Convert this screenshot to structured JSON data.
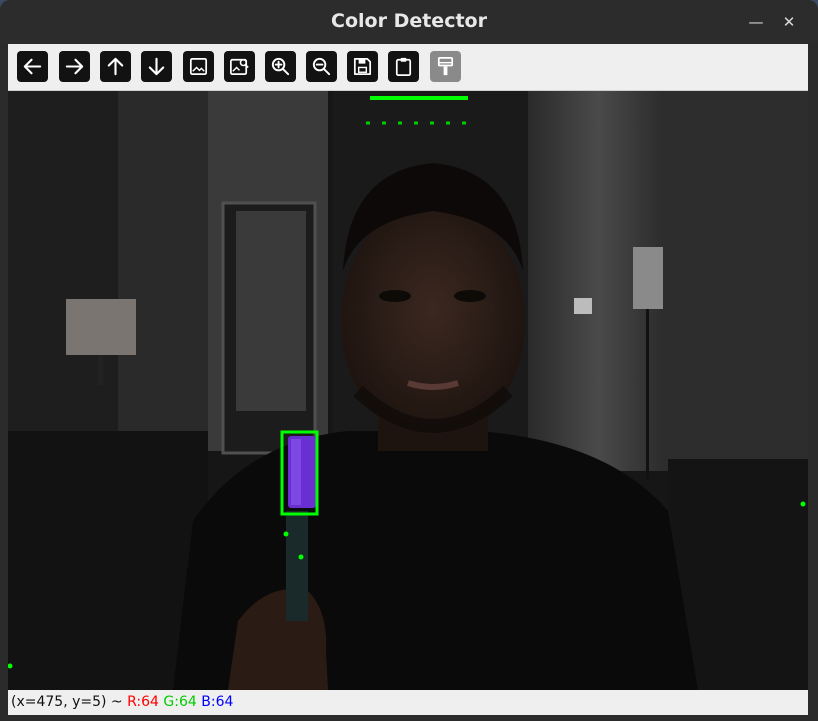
{
  "window": {
    "title": "Color Detector",
    "minimize_icon": "minimize-icon",
    "close_icon": "close-icon"
  },
  "toolbar": {
    "tools": [
      {
        "name": "pan-left",
        "icon": "arrow-left-icon"
      },
      {
        "name": "pan-right",
        "icon": "arrow-right-icon"
      },
      {
        "name": "pan-up",
        "icon": "arrow-up-icon"
      },
      {
        "name": "pan-down",
        "icon": "arrow-down-icon"
      },
      {
        "name": "zoom-fit",
        "icon": "image-icon"
      },
      {
        "name": "zoom-original",
        "icon": "image-search-icon"
      },
      {
        "name": "zoom-in",
        "icon": "zoom-in-icon"
      },
      {
        "name": "zoom-out",
        "icon": "zoom-out-icon"
      },
      {
        "name": "save",
        "icon": "save-icon"
      },
      {
        "name": "copy",
        "icon": "clipboard-icon"
      },
      {
        "name": "properties",
        "icon": "paint-roller-icon",
        "disabled": true
      }
    ]
  },
  "status": {
    "coords": "(x=475, y=5) ~ ",
    "r_label": "R:64",
    "g_label": "G:64",
    "b_label": "B:64",
    "r_color": "#ff0000",
    "g_color": "#00cc00",
    "b_color": "#0000ff"
  },
  "detection": {
    "box_color": "#00ff00",
    "object_color": "#6a2fd0"
  }
}
